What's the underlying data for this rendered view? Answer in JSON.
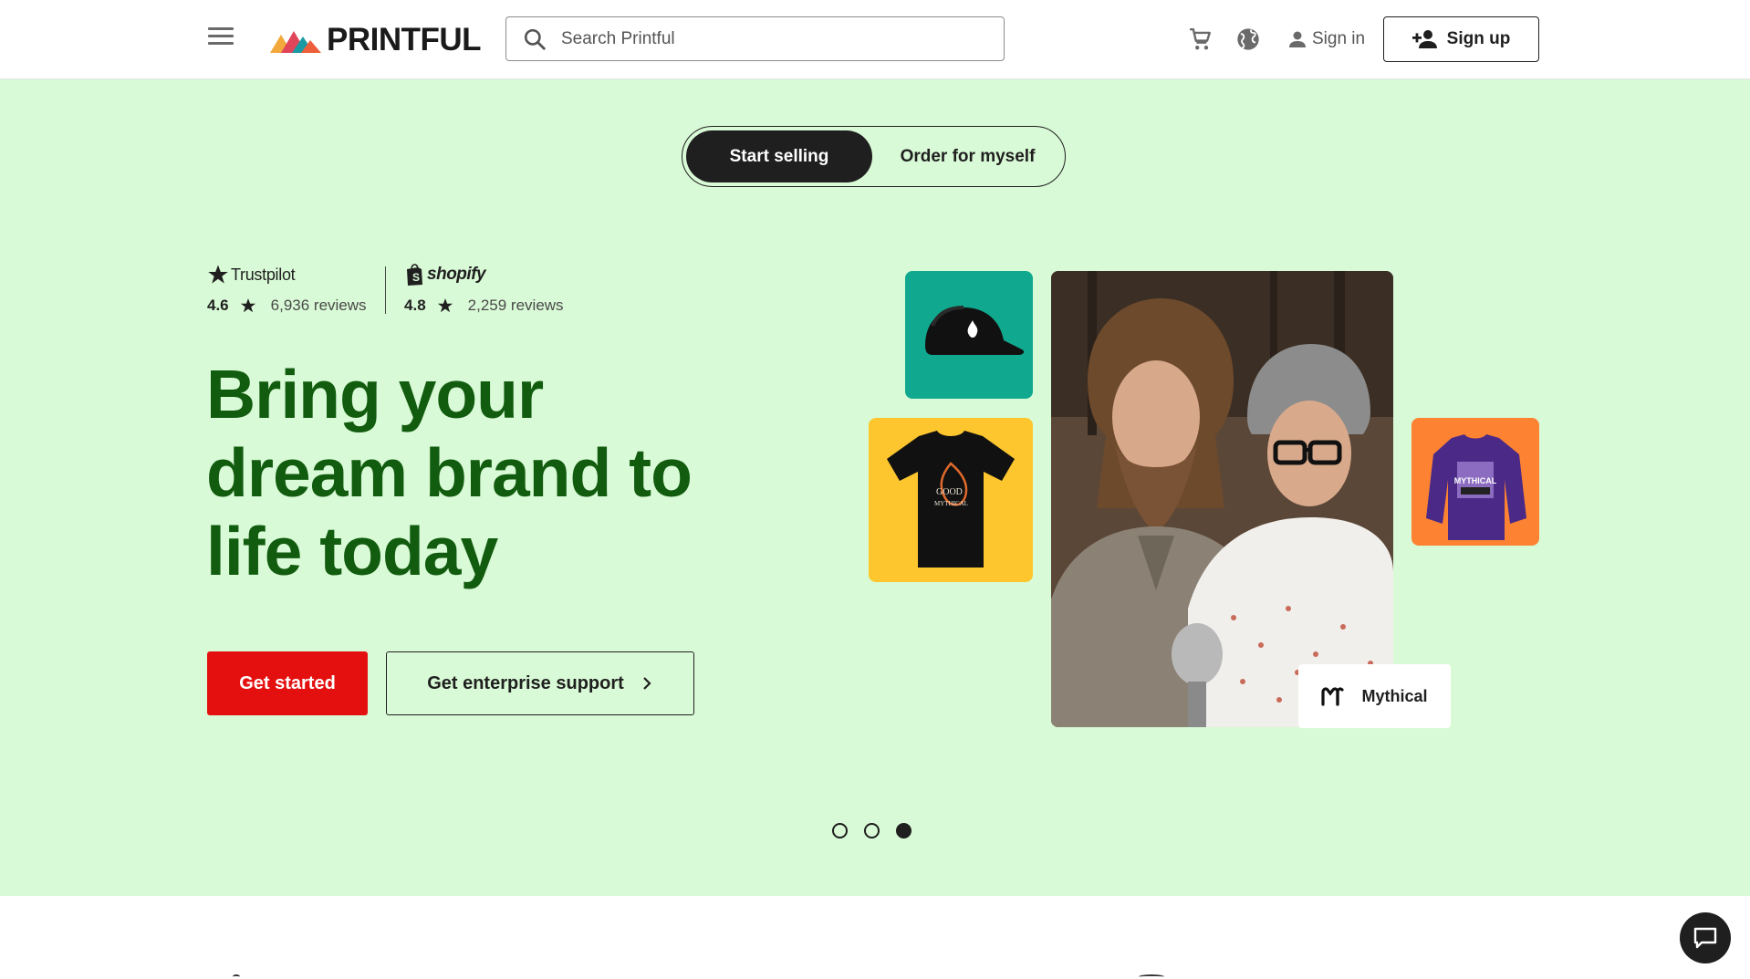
{
  "header": {
    "logo_text": "PRINTFUL",
    "search_placeholder": "Search Printful",
    "signin_label": "Sign in",
    "signup_label": "Sign up"
  },
  "hero": {
    "toggle": {
      "active_label": "Start selling",
      "inactive_label": "Order for myself"
    },
    "ratings": [
      {
        "brand": "Trustpilot",
        "score": "4.6",
        "reviews": "6,936 reviews"
      },
      {
        "brand": "shopify",
        "score": "4.8",
        "reviews": "2,259 reviews"
      }
    ],
    "headline": {
      "line1": "Bring your",
      "line2": "dream brand to",
      "line3": "life today"
    },
    "primary_cta": "Get started",
    "secondary_cta": "Get enterprise support",
    "brand_card_label": "Mythical",
    "sweatshirt_print": "MYTHICAL",
    "carousel": {
      "total": 3,
      "active_index": 3
    }
  },
  "colors": {
    "hero_bg": "#d9fad6",
    "headline": "#115c0f",
    "primary_button": "#e41010",
    "cap_tile": "#10a88e",
    "tee_tile": "#fec62e",
    "sweat_tile": "#fd8332"
  },
  "icons": [
    "menu-icon",
    "search-icon",
    "cart-icon",
    "globe-icon",
    "user-icon",
    "add-user-icon",
    "star-icon",
    "shopify-bag-icon",
    "chevron-right-icon",
    "mythical-logo-icon",
    "chat-icon"
  ]
}
